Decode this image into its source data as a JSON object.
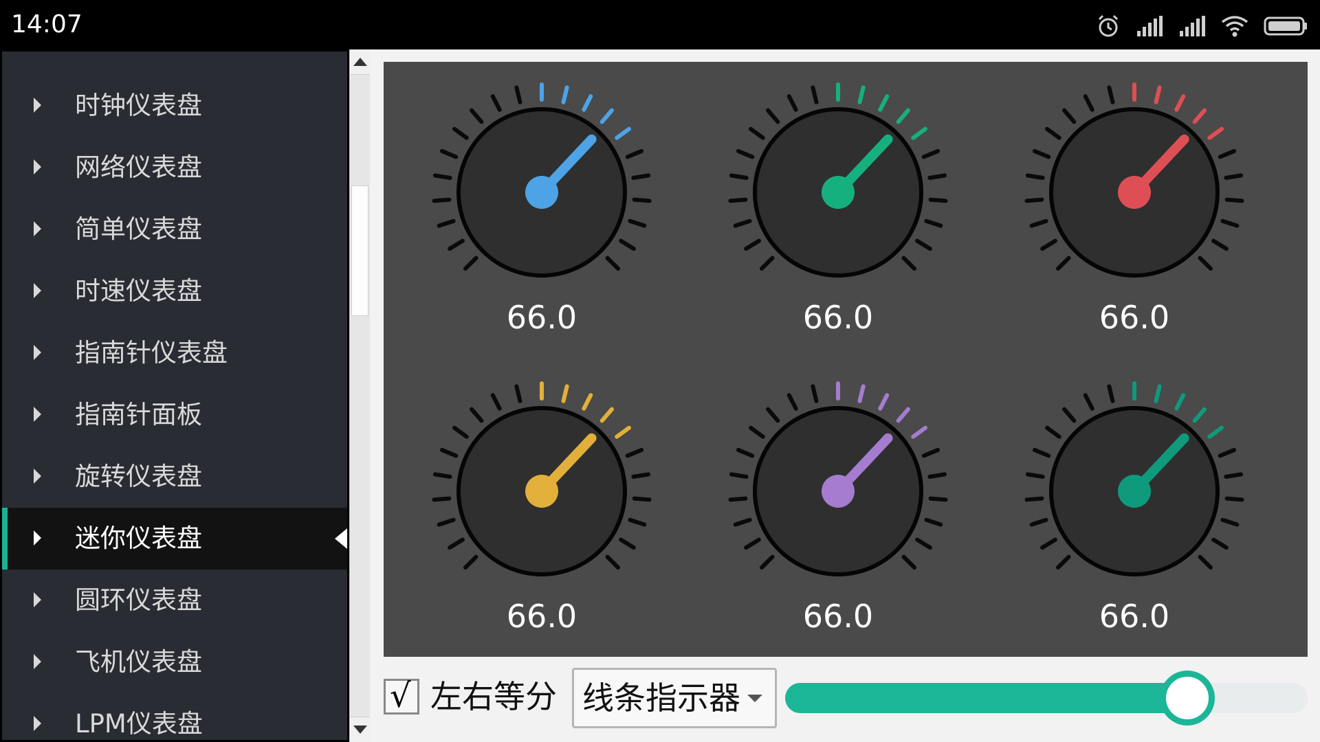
{
  "status_bar": {
    "time": "14:07",
    "icons": [
      "alarm-icon",
      "signal-icon",
      "signal-icon",
      "wifi-icon",
      "battery-icon"
    ]
  },
  "sidebar": {
    "items": [
      {
        "label": "时钟仪表盘",
        "active": false
      },
      {
        "label": "网络仪表盘",
        "active": false
      },
      {
        "label": "简单仪表盘",
        "active": false
      },
      {
        "label": "时速仪表盘",
        "active": false
      },
      {
        "label": "指南针仪表盘",
        "active": false
      },
      {
        "label": "指南针面板",
        "active": false
      },
      {
        "label": "旋转仪表盘",
        "active": false
      },
      {
        "label": "迷你仪表盘",
        "active": true
      },
      {
        "label": "圆环仪表盘",
        "active": false
      },
      {
        "label": "飞机仪表盘",
        "active": false
      },
      {
        "label": "LPM仪表盘",
        "active": false
      }
    ],
    "accent_color": "#19b393"
  },
  "gauges": [
    {
      "value_text": "66.0",
      "value": 66,
      "min": 0,
      "max": 100,
      "color": "#4da3e6"
    },
    {
      "value_text": "66.0",
      "value": 66,
      "min": 0,
      "max": 100,
      "color": "#16b07e"
    },
    {
      "value_text": "66.0",
      "value": 66,
      "min": 0,
      "max": 100,
      "color": "#de4f55"
    },
    {
      "value_text": "66.0",
      "value": 66,
      "min": 0,
      "max": 100,
      "color": "#e2b03a"
    },
    {
      "value_text": "66.0",
      "value": 66,
      "min": 0,
      "max": 100,
      "color": "#a57ccf"
    },
    {
      "value_text": "66.0",
      "value": 66,
      "min": 0,
      "max": 100,
      "color": "#0f9a7c"
    }
  ],
  "controls": {
    "checkbox_label": "左右等分",
    "checkbox_checked": true,
    "checkbox_mark": "√",
    "dropdown_value": "线条指示器",
    "slider_value": 0.77,
    "slider_color": "#1bb698"
  }
}
